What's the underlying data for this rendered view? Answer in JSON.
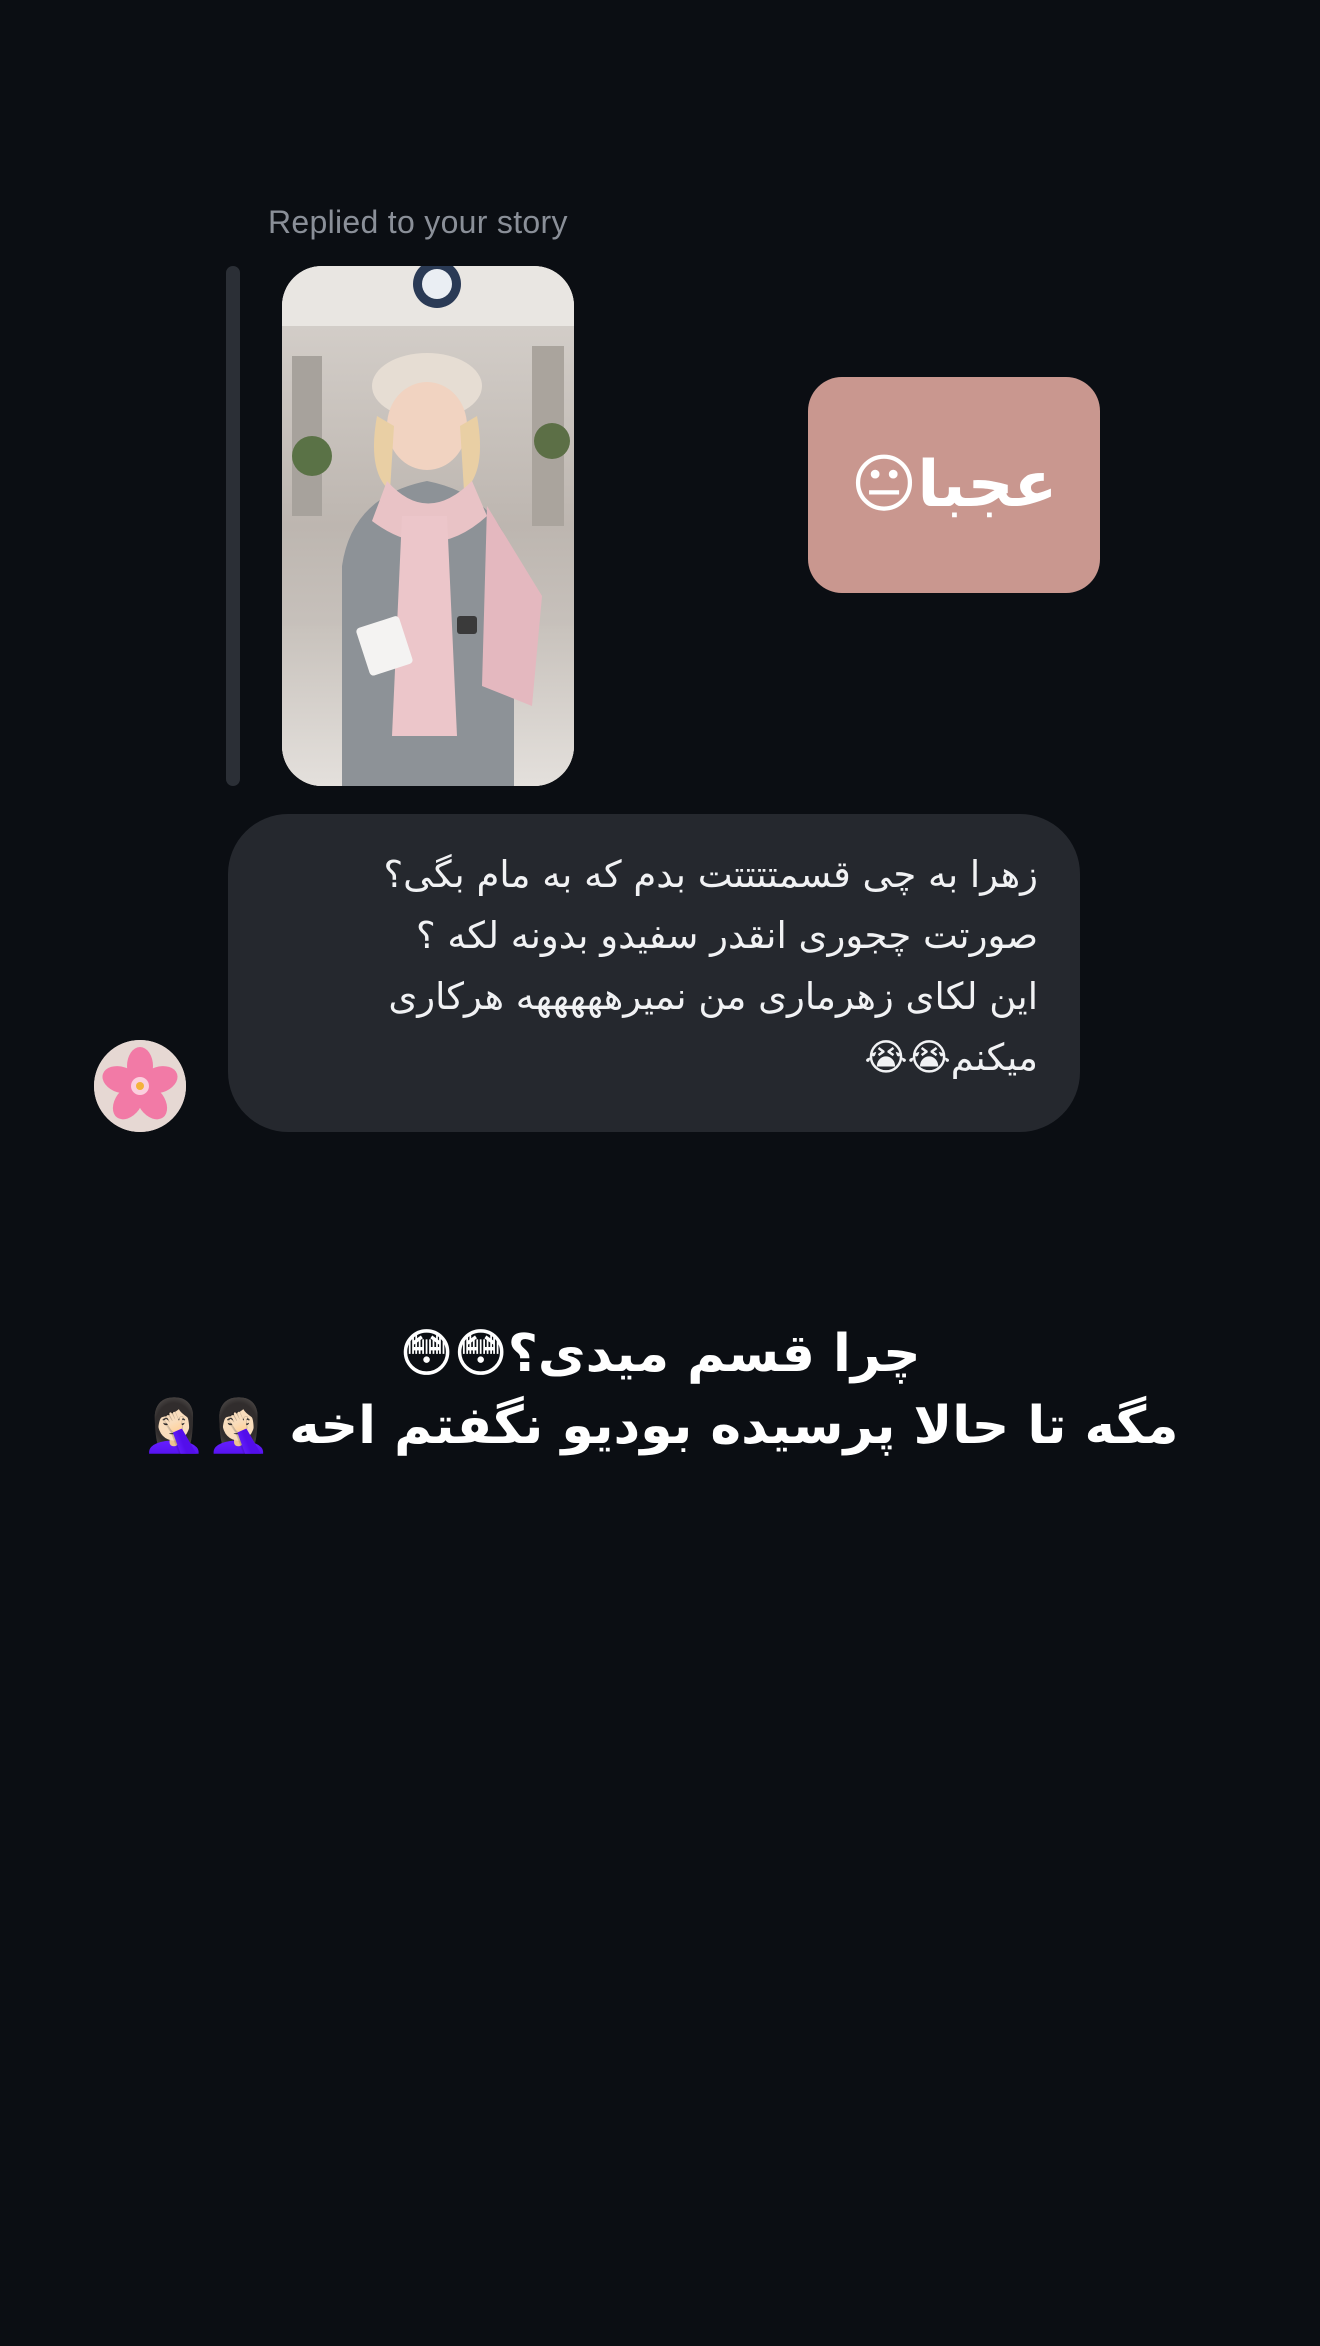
{
  "reply": {
    "caption": "Replied to your story"
  },
  "story": {
    "thumbnail_icon": "story-photo-thumbnail",
    "sticker_text": "عجبا😐"
  },
  "message": {
    "lines": [
      "زهرا به چی قسمتتتتت بدم که به مام بگی؟",
      "صورتت چجوری انقدر سفیدو بدونه لکه ؟",
      "این لکای زهرماری من نمیرهههههه هرکاری",
      "میکنم😭😭"
    ],
    "avatar_icon": "pink-flower-avatar-icon"
  },
  "overlay_caption": {
    "lines": [
      "چرا قسم میدی؟😳😳",
      "مگه تا حالا پرسیده بودیو نگفتم اخه 🤦🏻‍♀️🤦🏻‍♀️"
    ]
  },
  "colors": {
    "background": "#0b0e13",
    "bubble": "#25282e",
    "sticker": "#c9978f",
    "caption_gray": "#8a8f98",
    "quote_bar": "#2b2f36"
  }
}
